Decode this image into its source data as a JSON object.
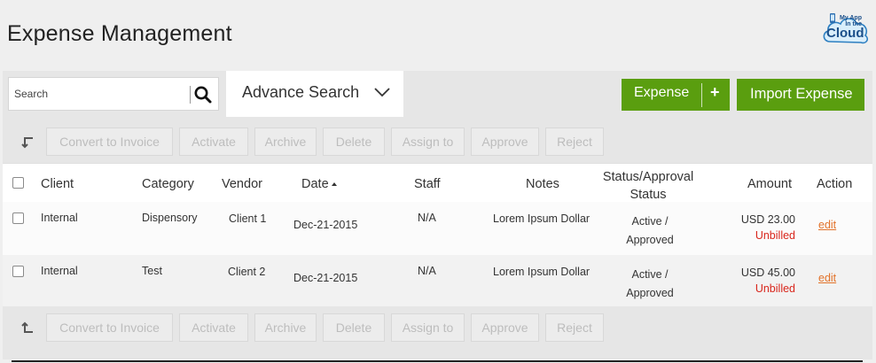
{
  "page": {
    "title": "Expense Management"
  },
  "logo": {
    "line1": "My App In the",
    "line2": "Cloud",
    "icon": "cloud-phone-logo"
  },
  "toolbar": {
    "search_placeholder": "Search",
    "search_icon": "search-icon",
    "advance_search_label": "Advance Search",
    "expense_button_label": "Expense",
    "expense_plus": "+",
    "import_button_label": "Import Expense",
    "accent_color": "#5a9e0f"
  },
  "bulk_actions": {
    "convert": "Convert to Invoice",
    "activate": "Activate",
    "archive": "Archive",
    "delete": "Delete",
    "assign": "Assign to",
    "approve": "Approve",
    "reject": "Reject"
  },
  "table": {
    "columns": {
      "client": "Client",
      "category": "Category",
      "vendor": "Vendor",
      "date": "Date",
      "staff": "Staff",
      "notes": "Notes",
      "status_line1": "Status/Approval",
      "status_line2": "Status",
      "amount": "Amount",
      "action": "Action"
    },
    "rows": [
      {
        "client": "Internal",
        "category": "Dispensory",
        "vendor": "Client 1",
        "date": "Dec-21-2015",
        "staff": "N/A",
        "notes": "Lorem Ipsum Dollar",
        "status_line1": "Active /",
        "status_line2": "Approved",
        "amount": "USD 23.00",
        "billing": "Unbilled",
        "action": "edit"
      },
      {
        "client": "Internal",
        "category": "Test",
        "vendor": "Client 2",
        "date": "Dec-21-2015",
        "staff": "N/A",
        "notes": "Lorem Ipsum Dollar",
        "status_line1": "Active /",
        "status_line2": "Approved",
        "amount": "USD 45.00",
        "billing": "Unbilled",
        "action": "edit"
      }
    ]
  }
}
